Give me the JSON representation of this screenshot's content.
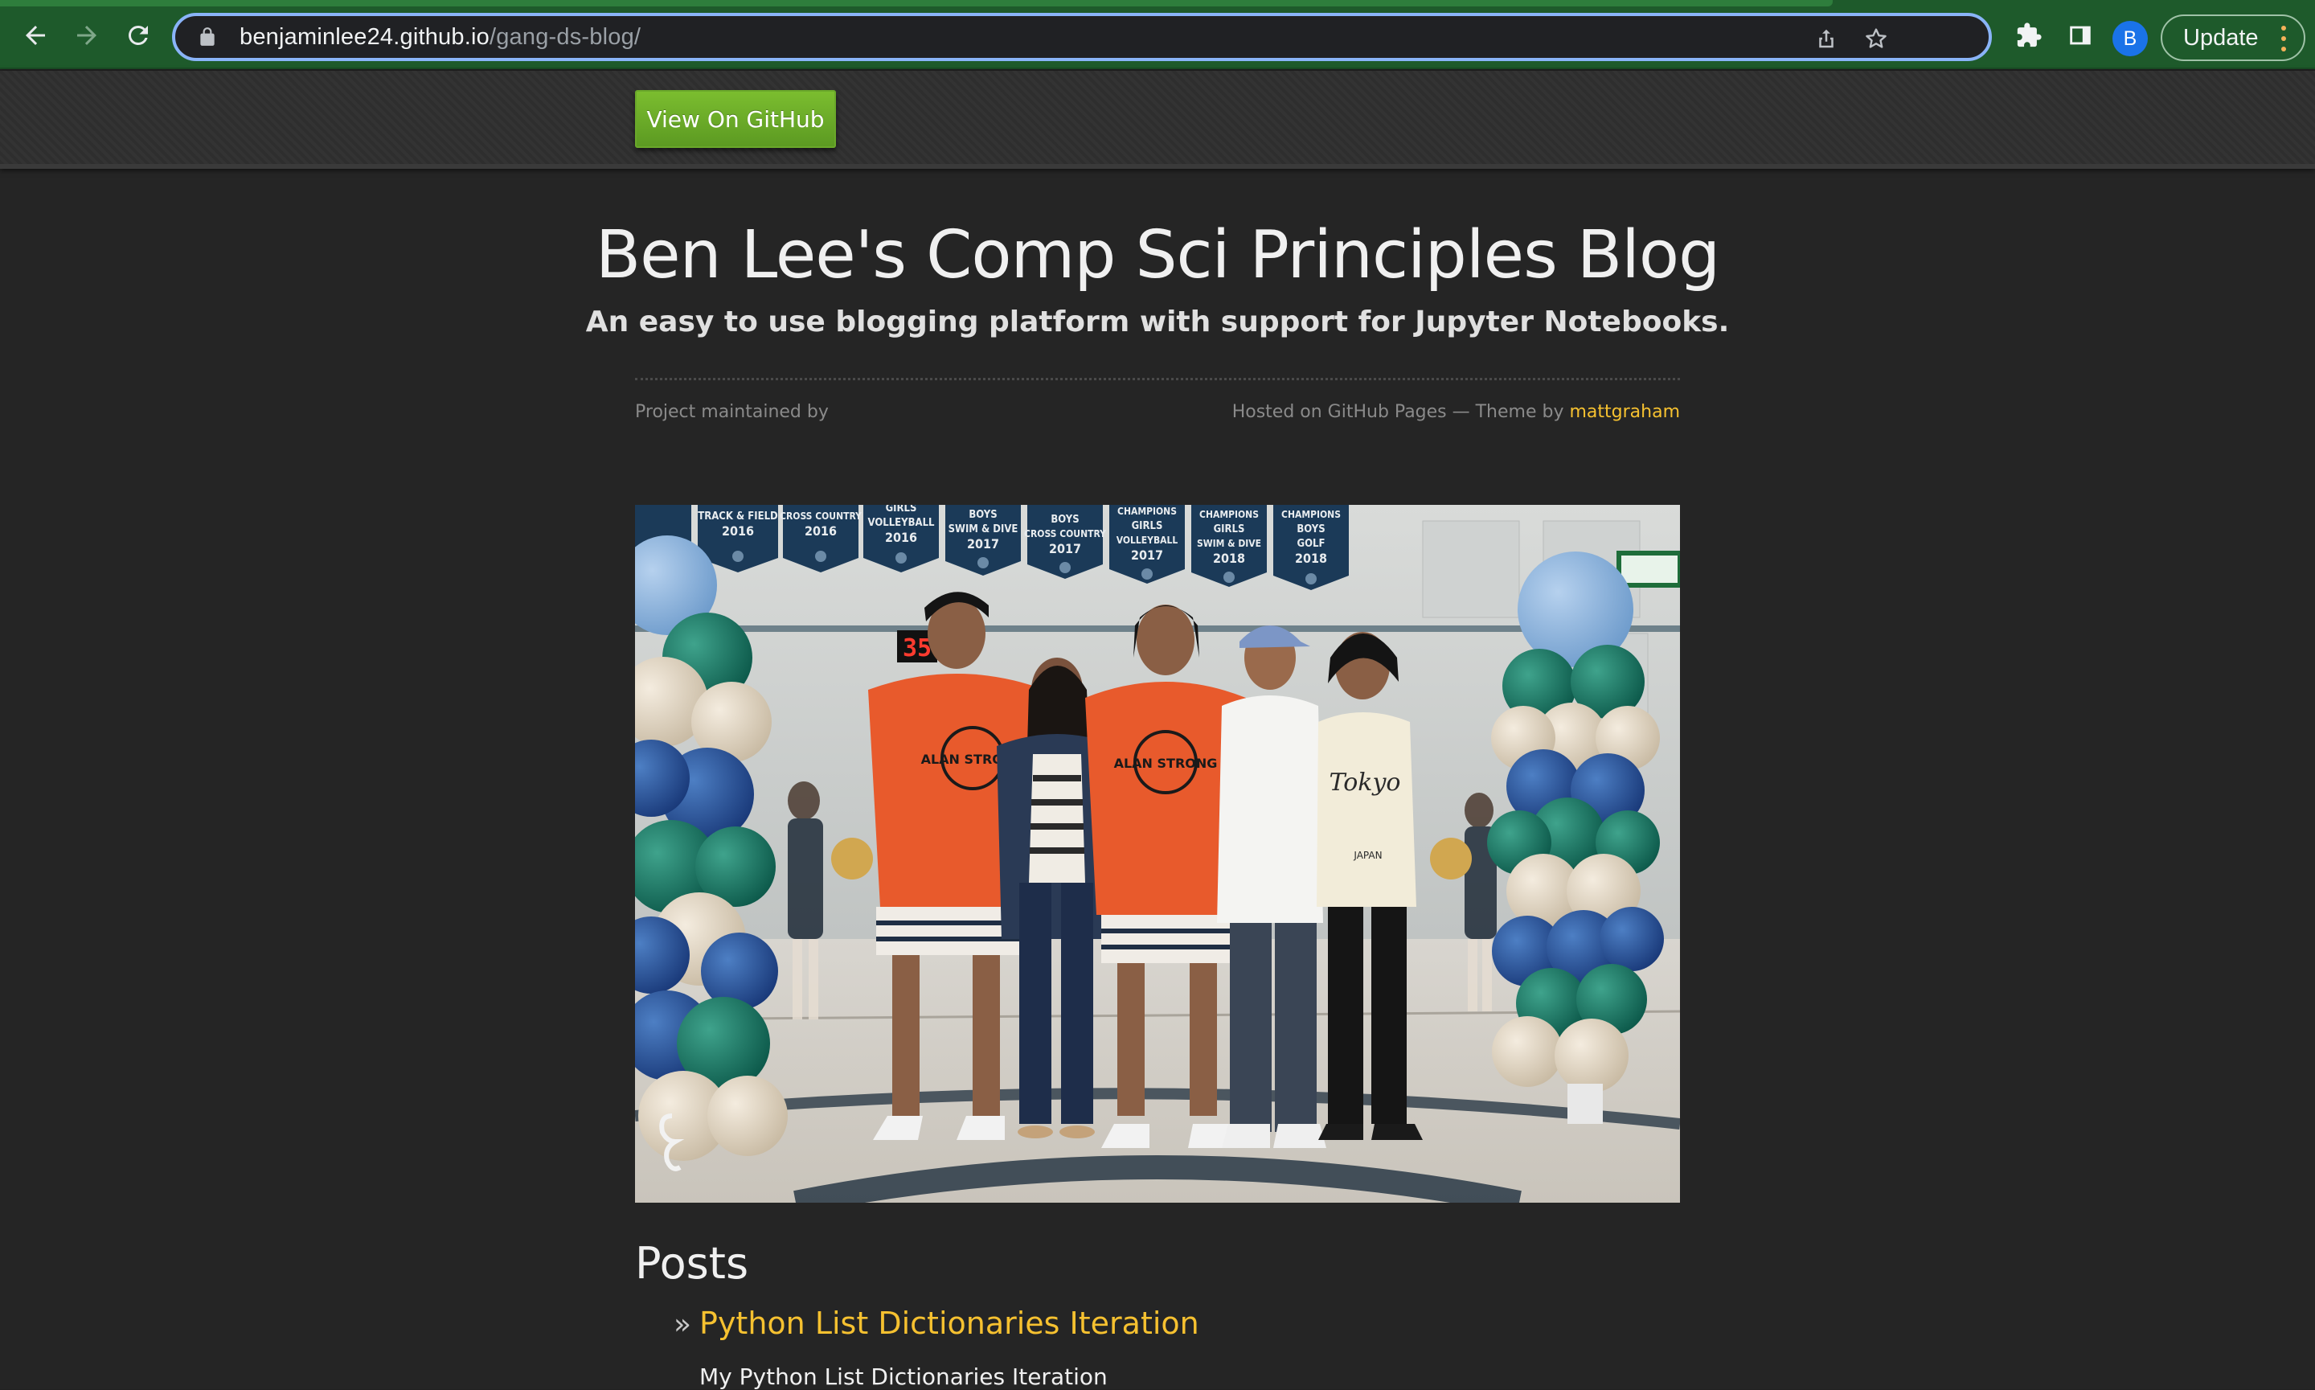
{
  "browser": {
    "url_host": "benjaminlee24.github.io",
    "url_path": "/gang-ds-blog/",
    "profile_initial": "B",
    "update_label": "Update",
    "icons": [
      "back-arrow-icon",
      "forward-arrow-icon",
      "reload-icon",
      "lock-icon",
      "share-icon",
      "star-icon",
      "extensions-puzzle-icon",
      "side-panel-icon",
      "kebab-menu-icon"
    ],
    "theme_color": "#1e5a2b",
    "focus_ring_color": "#8ab4f8"
  },
  "header": {
    "github_button_label": "View On GitHub",
    "button_color": "#6aa82a"
  },
  "site": {
    "title": "Ben Lee's Comp Sci Principles Blog",
    "tagline": "An easy to use blogging platform with support for Jupyter Notebooks.",
    "maintained_label": "Project maintained by",
    "hosted_label": "Hosted on GitHub Pages — Theme by",
    "theme_author": "mattgraham",
    "link_color": "#f6c130"
  },
  "hero_image": {
    "banners": [
      {
        "line1": "TRACK & FIELD",
        "line2": "2016"
      },
      {
        "line1": "CROSS COUNTRY",
        "line2": "2016"
      },
      {
        "line1": "GIRLS",
        "line2": "VOLLEYBALL",
        "line3": "2016"
      },
      {
        "line1": "BOYS",
        "line2": "SWIM & DIVE",
        "line3": "2017"
      },
      {
        "line1": "BOYS",
        "line2": "CROSS COUNTRY",
        "line3": "2017"
      },
      {
        "line1": "CHAMPIONS",
        "line2": "GIRLS",
        "line3": "VOLLEYBALL",
        "line4": "2017"
      },
      {
        "line1": "CHAMPIONS",
        "line2": "GIRLS",
        "line3": "SWIM & DIVE",
        "line4": "2018"
      },
      {
        "line1": "CHAMPIONS",
        "line2": "BOYS",
        "line3": "GOLF",
        "line4": "2018"
      }
    ],
    "scoreboard": "35",
    "shirt_text_1": "ALAN STRONG",
    "shirt_text_2": "ALAN STRONG",
    "shirt_text_3": "Tokyo",
    "shirt_text_4": "JAPAN"
  },
  "posts": {
    "heading": "Posts",
    "items": [
      {
        "title": "Python List Dictionaries Iteration",
        "description": "My Python List Dictionaries Iteration"
      }
    ]
  }
}
